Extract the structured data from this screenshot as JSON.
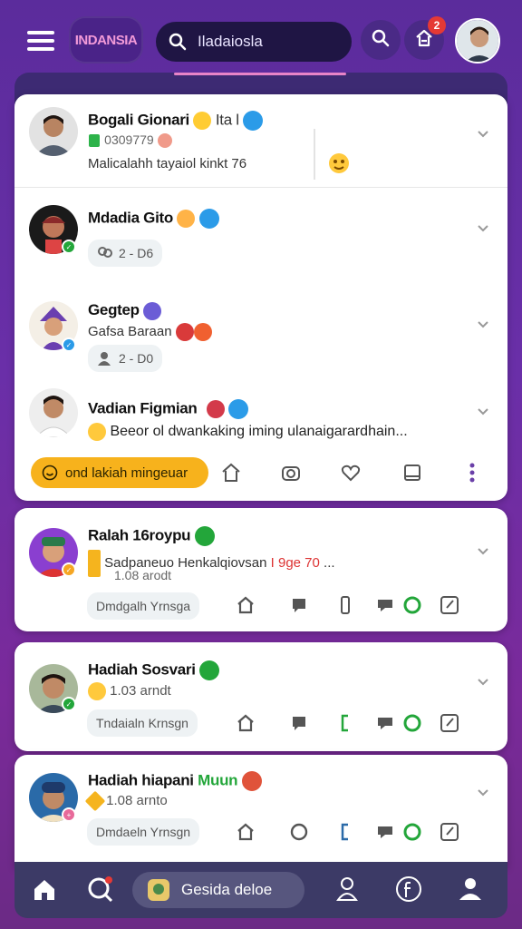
{
  "header": {
    "logo_text": "INDANSIA",
    "search_text": "Iladaiosla",
    "notification_count": "2"
  },
  "cards": [
    {
      "name": "Bogali Gionari",
      "name_suffix": "Ita l",
      "meta": "0309779",
      "desc": "Malicalahh tayaiol kinkt 76"
    },
    {
      "name": "Mdadia Gito",
      "chip": "2 - D6"
    },
    {
      "name": "Gegtep",
      "meta": "Gafsa Baraan",
      "chip": "2 - D0"
    },
    {
      "name": "Vadian Figmian",
      "desc": "Beeor ol dwankaking iming ulanaigarardhain..."
    }
  ],
  "cta_label": "ond lakiah mingeuar",
  "feed": [
    {
      "name": "Ralah 16roypu",
      "meta": "Sadpaneuo Henkalqiovsan",
      "meta_highlight": "I 9ge 70",
      "meta_tail": "...",
      "time": "1.08 arodt",
      "chip": "Dmdgalh Yrnsga"
    },
    {
      "name": "Hadiah Sosvari",
      "time": "1.03 arndt",
      "chip": "Tndaialn Krnsgn"
    },
    {
      "name": "Hadiah hiapani",
      "name_highlight": "Muun",
      "time": "1.08 arnto",
      "chip": "Dmdaeln Yrnsgn"
    }
  ],
  "bottom_nav": {
    "pill_label": "Gesida deloe"
  },
  "colors": {
    "accent_purple": "#6a2fa8",
    "cta_yellow": "#f7b21c",
    "verified_blue": "#2b9be8",
    "verified_green": "#23a63a",
    "badge_red": "#e53935"
  }
}
